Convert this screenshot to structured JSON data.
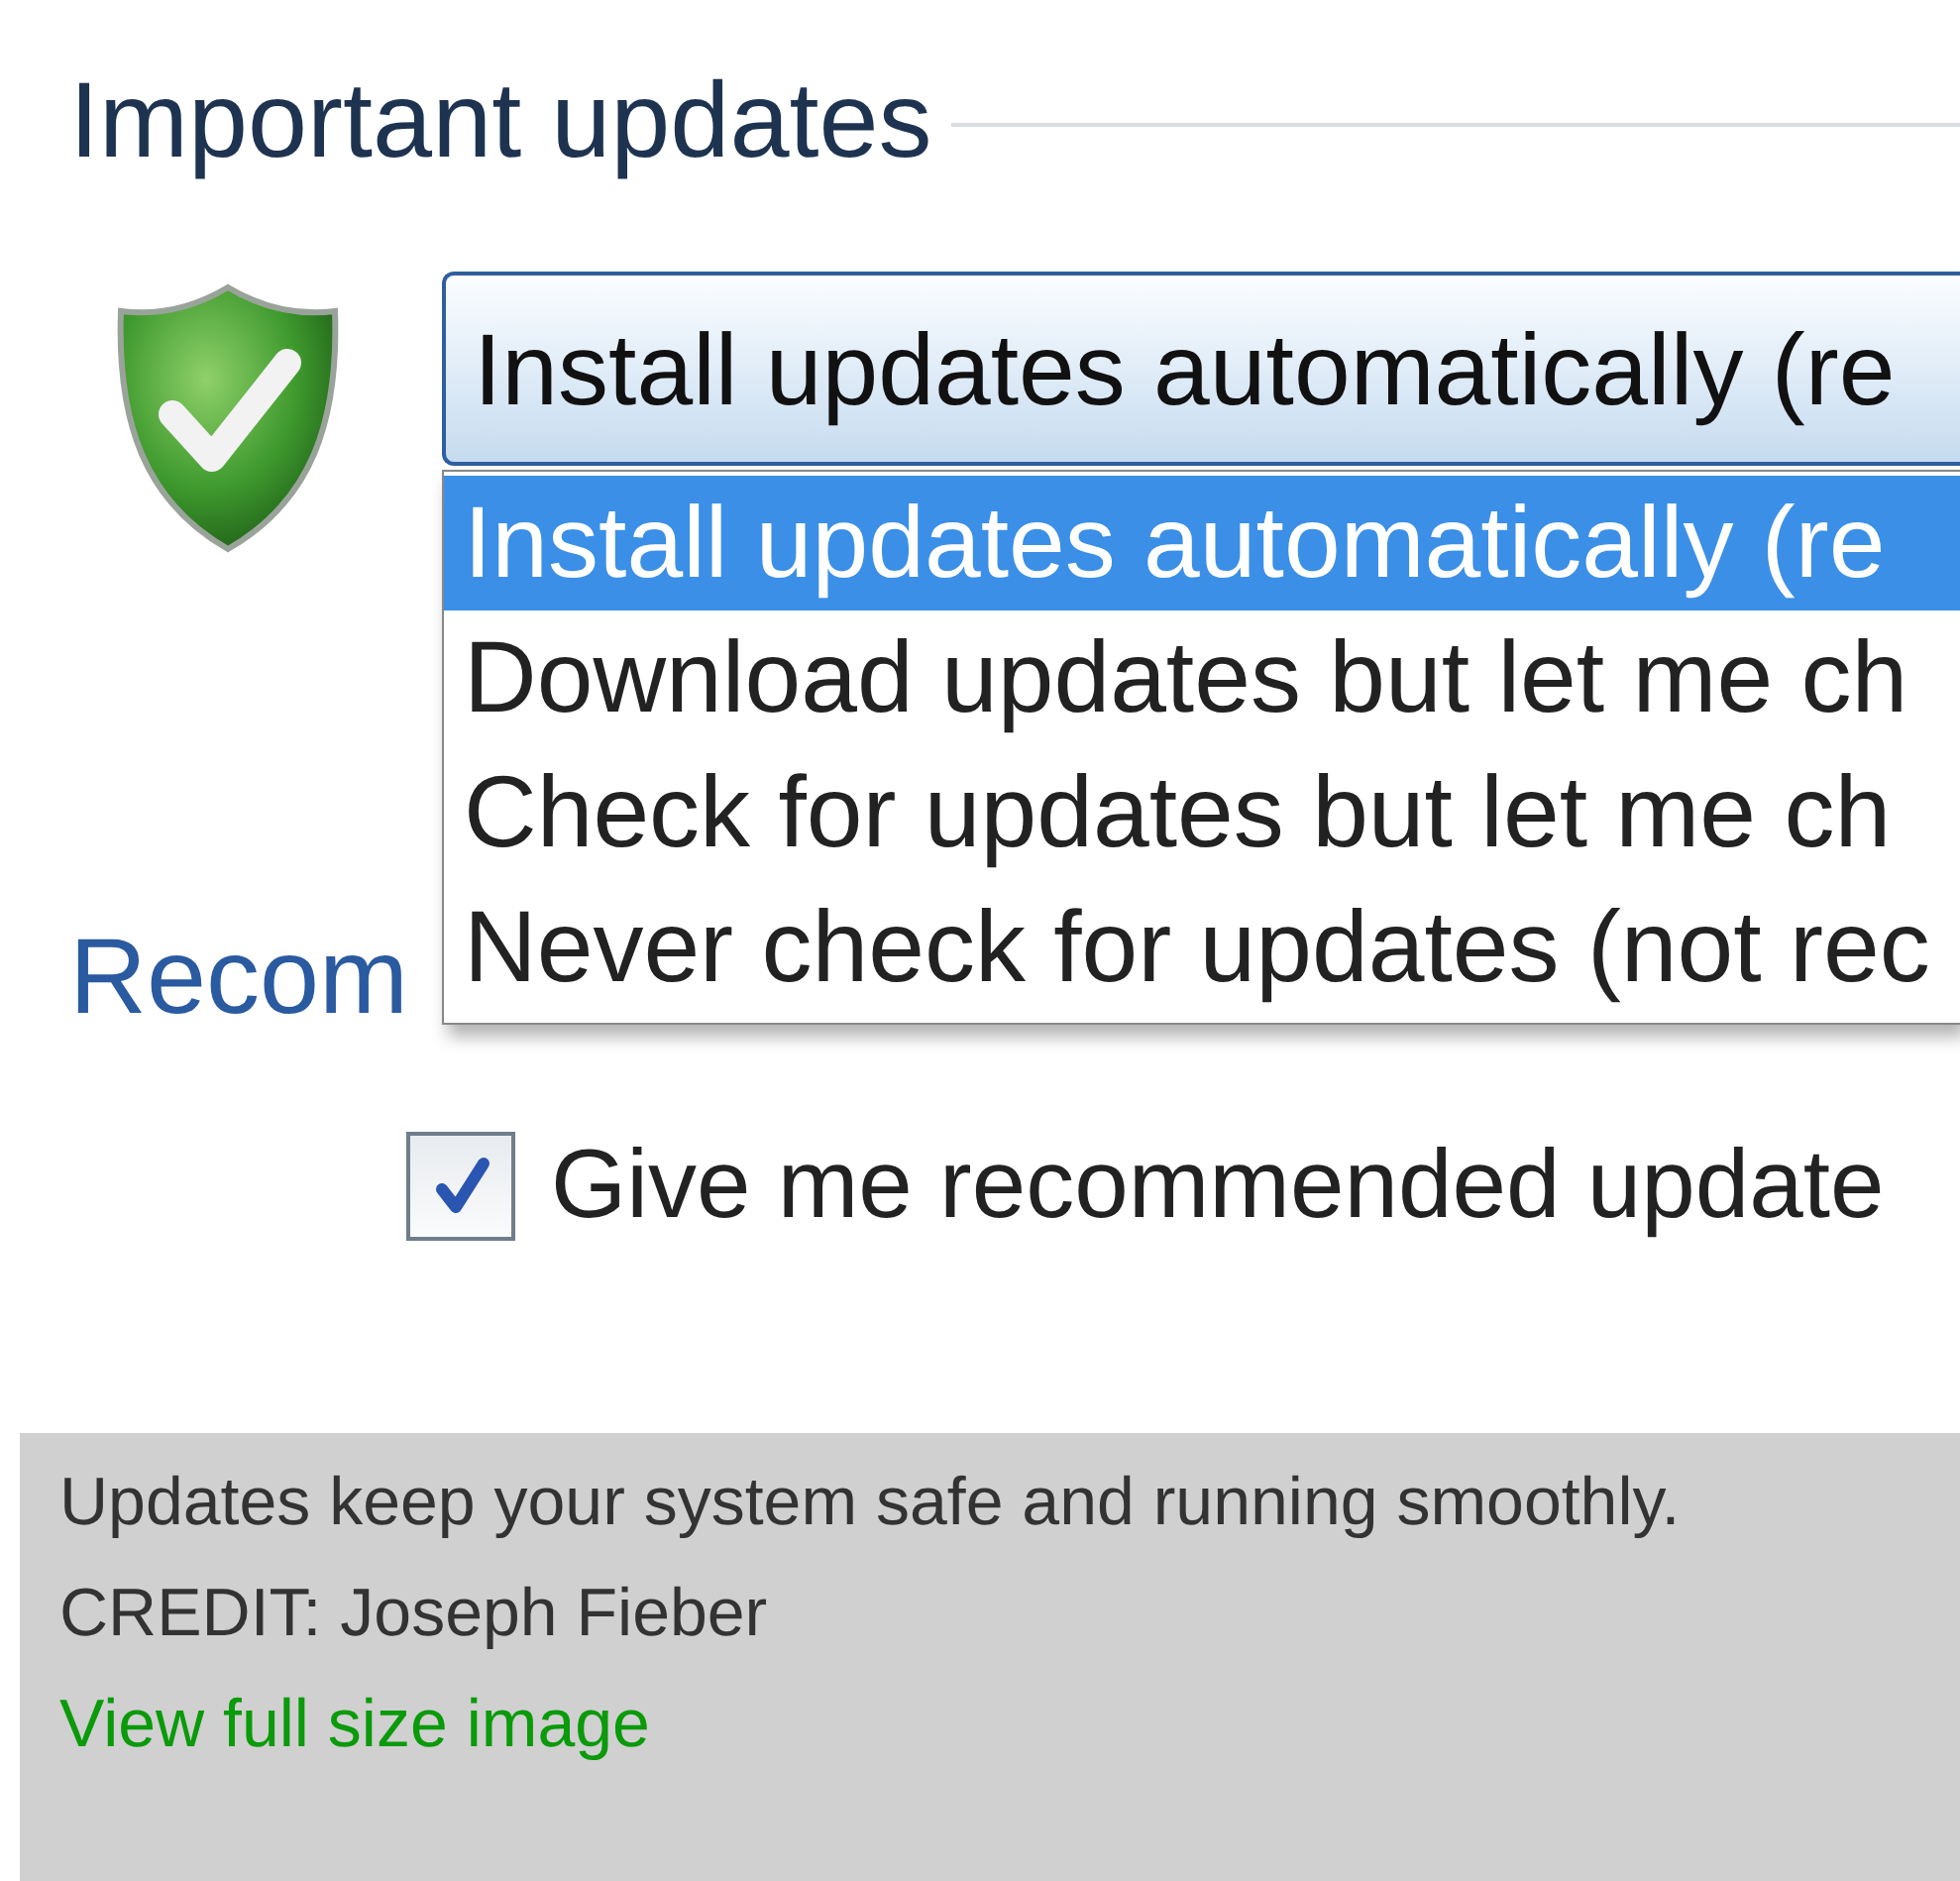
{
  "important_updates": {
    "title": "Important updates",
    "dropdown": {
      "value": "Install updates automatically (re",
      "expanded": true,
      "options": [
        {
          "label": "Install updates automatically (re",
          "selected": true
        },
        {
          "label": "Download updates but let me ch",
          "selected": false
        },
        {
          "label": "Check for updates but let me ch",
          "selected": false
        },
        {
          "label": "Never check for updates (not rec",
          "selected": false
        }
      ]
    }
  },
  "recommended_updates": {
    "title": "Recom",
    "checkbox": {
      "label": "Give me recommended update",
      "checked": true
    }
  },
  "caption": {
    "text": "Updates keep your system safe and running smoothly.",
    "credit": "CREDIT: Joseph Fieber",
    "link": "View full size image"
  }
}
